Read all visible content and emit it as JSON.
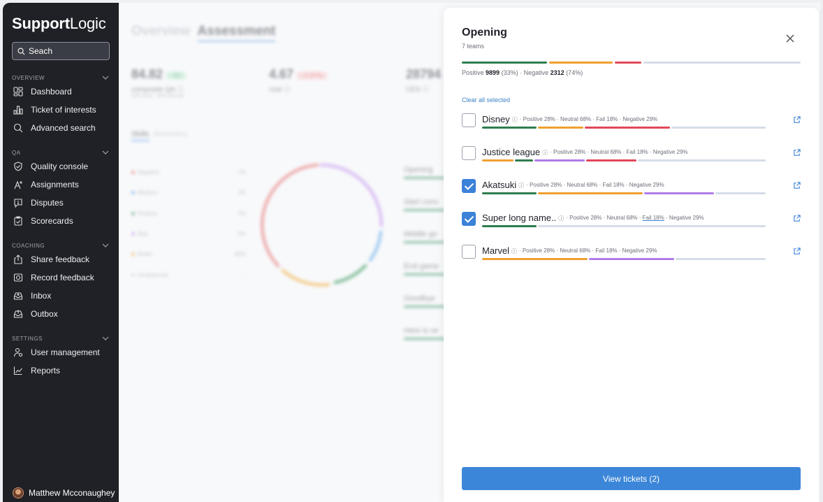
{
  "sidebar": {
    "brand_bold": "Support",
    "brand_rest": "Logic",
    "search_placeholder": "Seach",
    "sections": [
      {
        "title": "OVERVIEW",
        "items": [
          {
            "label": "Dashboard",
            "icon": "dashboard-icon"
          },
          {
            "label": "Ticket of interests",
            "icon": "chart-icon"
          },
          {
            "label": "Advanced search",
            "icon": "search-icon"
          }
        ]
      },
      {
        "title": "QA",
        "items": [
          {
            "label": "Quality console",
            "icon": "shield-check-icon"
          },
          {
            "label": "Assignments",
            "icon": "assignment-icon"
          },
          {
            "label": "Disputes",
            "icon": "dispute-icon"
          },
          {
            "label": "Scorecards",
            "icon": "scorecard-icon"
          }
        ]
      },
      {
        "title": "COACHING",
        "items": [
          {
            "label": "Share feedback",
            "icon": "share-icon"
          },
          {
            "label": "Record feedback",
            "icon": "camera-icon"
          },
          {
            "label": "Inbox",
            "icon": "inbox-icon"
          },
          {
            "label": "Outbox",
            "icon": "outbox-icon"
          }
        ]
      },
      {
        "title": "SETTINGS",
        "items": [
          {
            "label": "User management",
            "icon": "user-settings-icon"
          },
          {
            "label": "Reports",
            "icon": "reports-icon"
          }
        ]
      }
    ],
    "user_name": "Matthew Mcconaughey"
  },
  "background": {
    "tab_overview": "Overview",
    "tab_assessment": "Assessment",
    "metric1": {
      "value": "84.82",
      "badge": "↑ 50↓",
      "label": "composite QA ⓘ",
      "sub": "50% Auto · 50% Manual"
    },
    "metric2": {
      "value": "4.67",
      "badge": "↓ 2.37%↓",
      "label": "cost ⓘ"
    },
    "metric3": {
      "value": "28794",
      "label": "CES ⓘ"
    },
    "subtab_skills": "Skills",
    "subtab_behaviors": "Behaviors",
    "legend": [
      {
        "name": "Negative",
        "value": "7%",
        "color": "#e05a5a"
      },
      {
        "name": "Medium",
        "value": "2%",
        "color": "#4a90e2"
      },
      {
        "name": "Positive",
        "value": "5%",
        "color": "#2e8b57"
      },
      {
        "name": "Bad",
        "value": "3%",
        "color": "#b57be8"
      },
      {
        "name": "Better",
        "value": "86%",
        "color": "#f0a830"
      },
      {
        "name": "Unobserved",
        "value": "-",
        "color": "#cccccc"
      }
    ],
    "skills": [
      "Opening",
      "Start conv",
      "Middle go",
      "End game",
      "Goodbye",
      "Here is ve"
    ]
  },
  "panel": {
    "title": "Opening",
    "subtitle": "7 teams",
    "positive_label": "Positive",
    "positive_value": "9899",
    "positive_pct": "(33%)",
    "negative_label": "Negative",
    "negative_value": "2312",
    "negative_pct": "(74%)",
    "clear_all": "Clear all selected",
    "teams": [
      {
        "name": "Disney",
        "checked": false,
        "stats_pre": "· Positive 28% · Neutral 68% · ",
        "fail": "Fail 18%",
        "stats_post": " · Negative 29%"
      },
      {
        "name": "Justice league",
        "checked": false,
        "stats_pre": "· Positive 28% · Neutral 68% · ",
        "fail": "Fail 18%",
        "stats_post": " · Negative 29%"
      },
      {
        "name": "Akatsuki",
        "checked": true,
        "stats_pre": "· Positive 28% · Neutral 68% · ",
        "fail": "Fail 18%",
        "stats_post": " · Negative 29%"
      },
      {
        "name": "Super long name..",
        "checked": true,
        "stats_pre": "· Positive 28% · Neutral 68% · ",
        "fail": "Fail 18%",
        "stats_post": " · Negative 29%"
      },
      {
        "name": "Marvel",
        "checked": false,
        "stats_pre": "· Positive 28% · Neutral 68% · ",
        "fail": "Fail 18%",
        "stats_post": " · Negative 29%"
      }
    ],
    "button_label": "View tickets (2)",
    "colors": {
      "green": "#2e7d4f",
      "orange": "#f0a030",
      "red": "#e0485a",
      "purple": "#b07be8",
      "gray": "#d5dde8",
      "blue": "#3b86d8"
    }
  }
}
